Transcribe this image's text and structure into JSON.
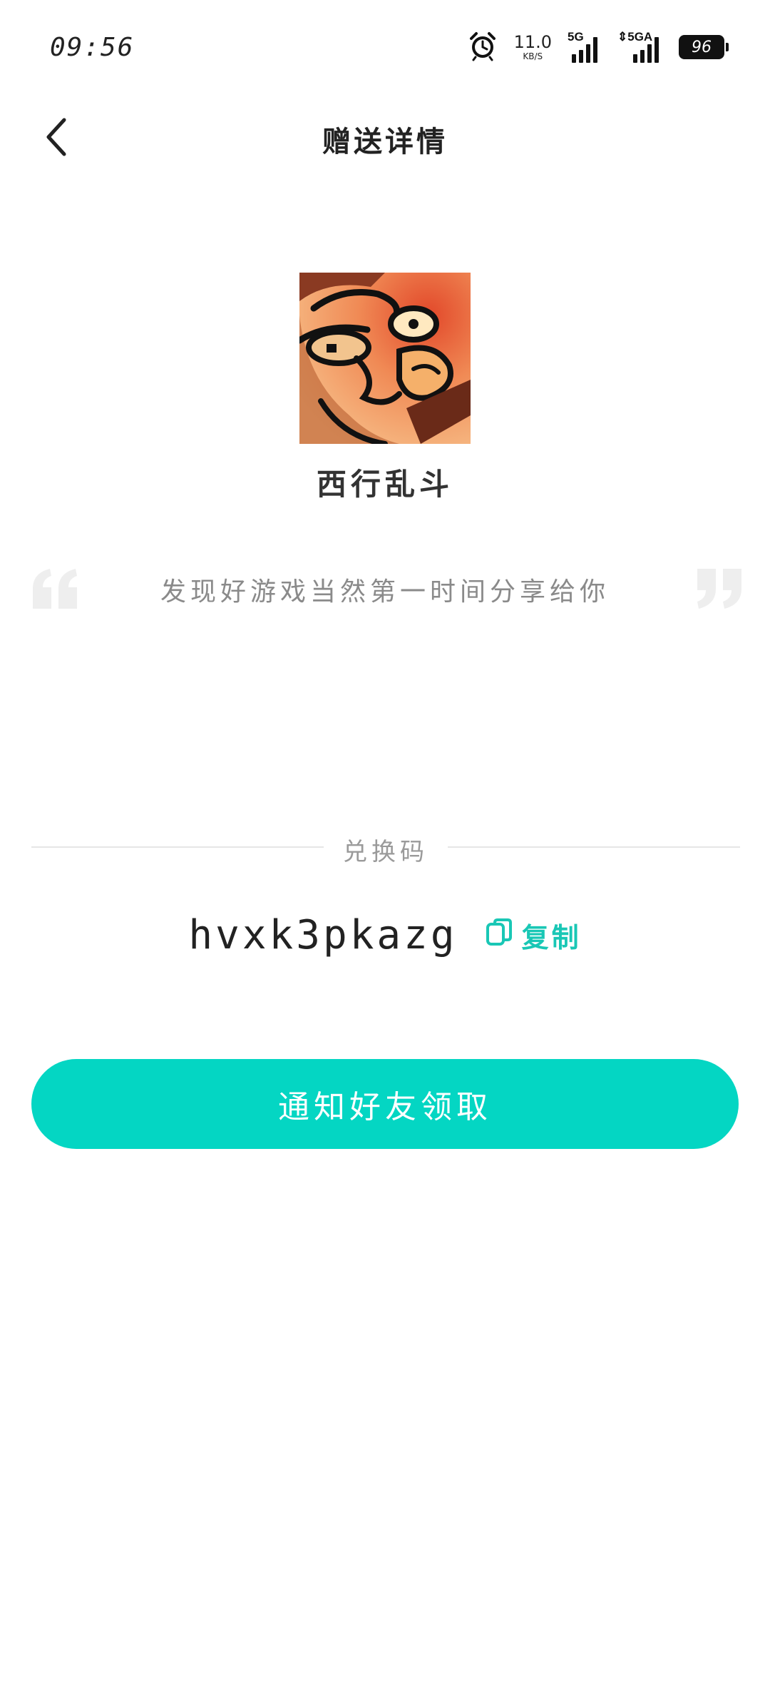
{
  "status_bar": {
    "time": "09:56",
    "net_speed_value": "11.0",
    "net_speed_unit": "KB/S",
    "signal1_label": "5G",
    "signal2_label": "5GA",
    "battery_level": "96",
    "icons": [
      "alarm-icon",
      "signal-5g-icon",
      "signal-5ga-icon",
      "battery-icon"
    ]
  },
  "header": {
    "title": "赠送详情",
    "back_icon": "chevron-left-icon"
  },
  "game": {
    "name": "西行乱斗"
  },
  "quote": {
    "text": "发现好游戏当然第一时间分享给你"
  },
  "code_section": {
    "label": "兑换码",
    "code": "hvxk3pkazg",
    "copy_label": "复制",
    "copy_icon": "copy-icon"
  },
  "actions": {
    "notify_label": "通知好友领取"
  },
  "colors": {
    "accent": "#04d6c3",
    "copy_text": "#19c7b5",
    "quote_mark": "#eeeeee",
    "muted_text": "#8a8a8a"
  }
}
